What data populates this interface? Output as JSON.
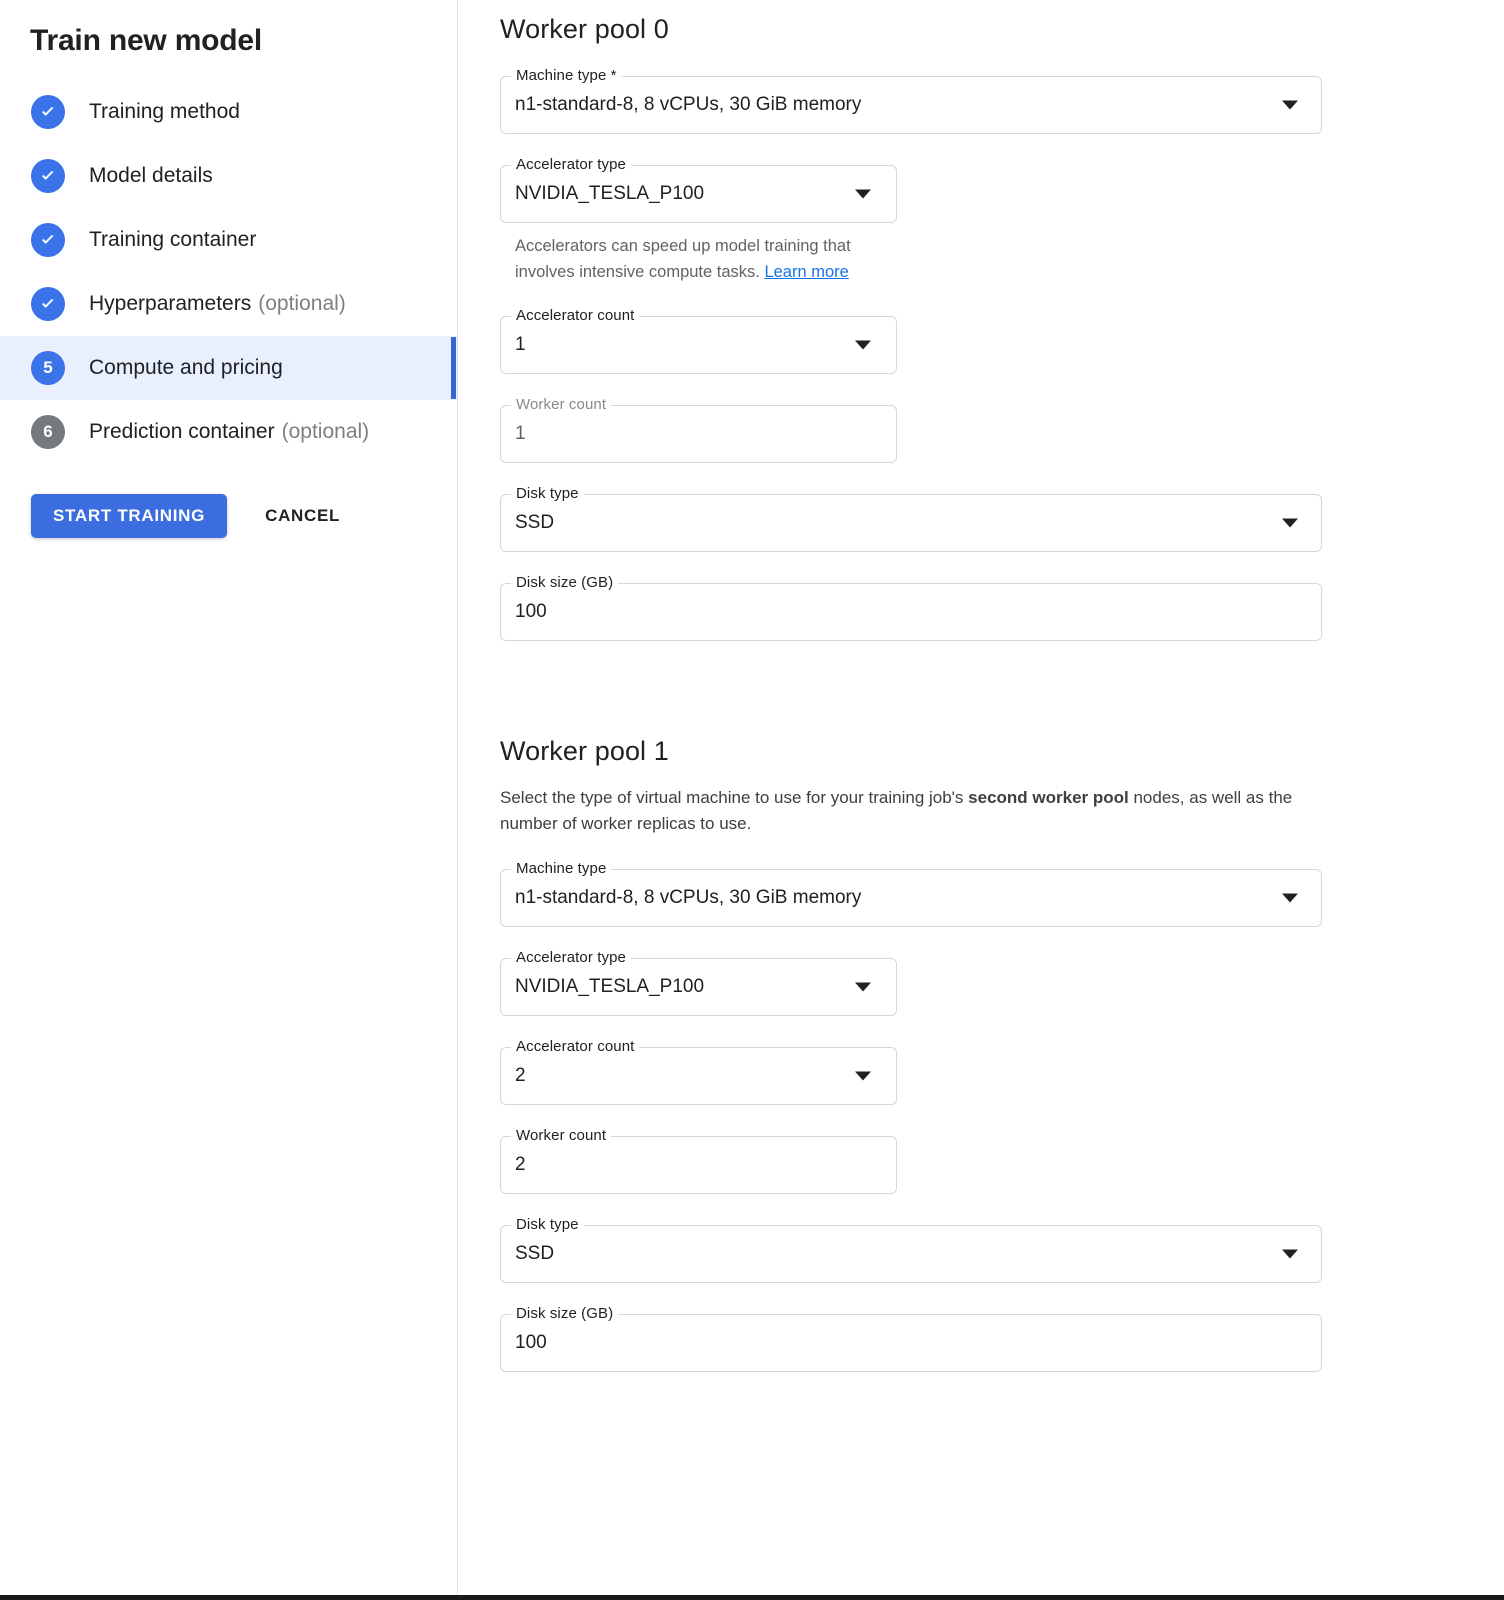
{
  "sidebar": {
    "title": "Train new model",
    "steps": [
      {
        "badge": "check",
        "label": "Training method",
        "optional": "",
        "state": "done"
      },
      {
        "badge": "check",
        "label": "Model details",
        "optional": "",
        "state": "done"
      },
      {
        "badge": "check",
        "label": "Training container",
        "optional": "",
        "state": "done"
      },
      {
        "badge": "check",
        "label": "Hyperparameters",
        "optional": "(optional)",
        "state": "done"
      },
      {
        "badge": "5",
        "label": "Compute and pricing",
        "optional": "",
        "state": "current"
      },
      {
        "badge": "6",
        "label": "Prediction container",
        "optional": "(optional)",
        "state": "pending"
      }
    ],
    "actions": {
      "primary_label": "START TRAINING",
      "secondary_label": "CANCEL"
    }
  },
  "colors": {
    "accent_blue": "#3367d6",
    "badge_blue": "#3b73e8",
    "badge_grey": "#75787c",
    "button_blue": "#3b6de0",
    "active_row_bg": "#e9f0fd",
    "link_blue": "#1a73e8"
  },
  "pools": [
    {
      "title": "Worker pool 0",
      "description": "",
      "fields": [
        {
          "label": "Machine type *",
          "value": "n1-standard-8, 8 vCPUs, 30 GiB memory",
          "control": "select",
          "width": "wide",
          "disabled": false
        },
        {
          "label": "Accelerator type",
          "value": "NVIDIA_TESLA_P100",
          "control": "select",
          "width": "narrow",
          "disabled": false,
          "helper": {
            "text_before": "Accelerators can speed up model training that involves intensive compute tasks. ",
            "link": "Learn more"
          }
        },
        {
          "label": "Accelerator count",
          "value": "1",
          "control": "select",
          "width": "narrow",
          "disabled": false
        },
        {
          "label": "Worker count",
          "value": "1",
          "control": "input",
          "width": "narrow",
          "disabled": true
        },
        {
          "label": "Disk type",
          "value": "SSD",
          "control": "select",
          "width": "wide",
          "disabled": false
        },
        {
          "label": "Disk size (GB)",
          "value": "100",
          "control": "input",
          "width": "wide",
          "disabled": false
        }
      ]
    },
    {
      "title": "Worker pool 1",
      "description_before": "Select the type of virtual machine to use for your training job's ",
      "description_bold": "second worker pool",
      "description_after": " nodes, as well as the number of worker replicas to use.",
      "fields": [
        {
          "label": "Machine type",
          "value": "n1-standard-8, 8 vCPUs, 30 GiB memory",
          "control": "select",
          "width": "wide",
          "disabled": false
        },
        {
          "label": "Accelerator type",
          "value": "NVIDIA_TESLA_P100",
          "control": "select",
          "width": "narrow",
          "disabled": false
        },
        {
          "label": "Accelerator count",
          "value": "2",
          "control": "select",
          "width": "narrow",
          "disabled": false
        },
        {
          "label": "Worker count",
          "value": "2",
          "control": "input",
          "width": "narrow",
          "disabled": false
        },
        {
          "label": "Disk type",
          "value": "SSD",
          "control": "select",
          "width": "wide",
          "disabled": false
        },
        {
          "label": "Disk size (GB)",
          "value": "100",
          "control": "input",
          "width": "wide",
          "disabled": false
        }
      ]
    }
  ]
}
